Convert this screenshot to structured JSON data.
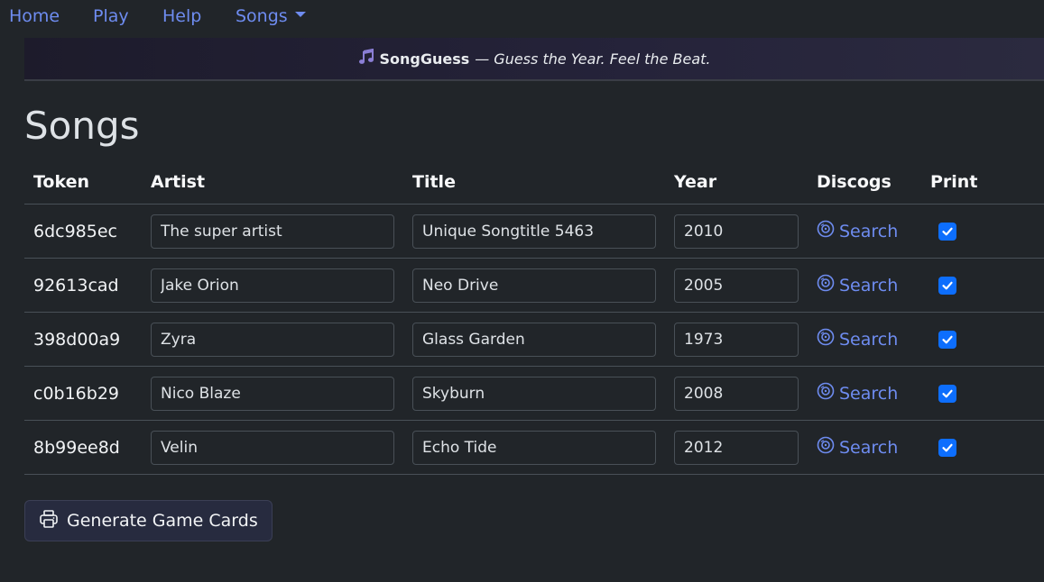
{
  "nav": {
    "home": "Home",
    "play": "Play",
    "help": "Help",
    "songs": "Songs"
  },
  "banner": {
    "brand": "SongGuess",
    "separator": "—",
    "tagline": "Guess the Year. Feel the Beat."
  },
  "page": {
    "title": "Songs"
  },
  "table": {
    "headers": [
      "Token",
      "Artist",
      "Title",
      "Year",
      "Discogs",
      "Print"
    ],
    "rows": [
      {
        "token": "6dc985ec",
        "artist": "The super artist",
        "title": "Unique Songtitle 5463",
        "year": "2010",
        "discogs": "Search",
        "print": true
      },
      {
        "token": "92613cad",
        "artist": "Jake Orion",
        "title": "Neo Drive",
        "year": "2005",
        "discogs": "Search",
        "print": true
      },
      {
        "token": "398d00a9",
        "artist": "Zyra",
        "title": "Glass Garden",
        "year": "1973",
        "discogs": "Search",
        "print": true
      },
      {
        "token": "c0b16b29",
        "artist": "Nico Blaze",
        "title": "Skyburn",
        "year": "2008",
        "discogs": "Search",
        "print": true
      },
      {
        "token": "8b99ee8d",
        "artist": "Velin",
        "title": "Echo Tide",
        "year": "2012",
        "discogs": "Search",
        "print": true
      }
    ]
  },
  "actions": {
    "generate_label": "Generate Game Cards"
  },
  "icons": {
    "banner": "music-note-icon",
    "discogs": "vinyl-disc-icon",
    "print": "printer-icon",
    "checkbox": "checkmark-icon"
  },
  "colors": {
    "link": "#6e8cf0",
    "checkbox": "#0d6efd",
    "background": "#212529"
  }
}
